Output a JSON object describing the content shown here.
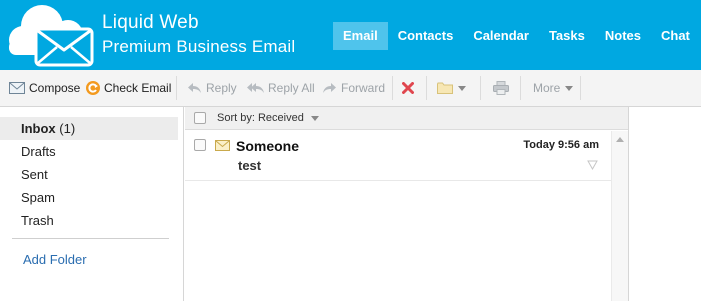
{
  "brand": {
    "line1": "Liquid Web",
    "line2": "Premium Business Email"
  },
  "nav": [
    {
      "label": "Email",
      "active": true
    },
    {
      "label": "Contacts"
    },
    {
      "label": "Calendar"
    },
    {
      "label": "Tasks"
    },
    {
      "label": "Notes"
    },
    {
      "label": "Chat"
    }
  ],
  "toolbar": {
    "compose": "Compose",
    "check_email": "Check Email",
    "reply": "Reply",
    "reply_all": "Reply All",
    "forward": "Forward",
    "more": "More"
  },
  "folders": [
    {
      "label": "Inbox",
      "count": "(1)",
      "active": true
    },
    {
      "label": "Drafts"
    },
    {
      "label": "Sent"
    },
    {
      "label": "Spam"
    },
    {
      "label": "Trash"
    }
  ],
  "add_folder": "Add Folder",
  "list": {
    "sort_label": "Sort by: Received",
    "messages": [
      {
        "sender": "Someone",
        "subject": "test",
        "time": "Today 9:56 am",
        "unread": true
      }
    ]
  },
  "colors": {
    "header": "#00a8e1",
    "nav_active": "#4fc4ec",
    "link": "#2a6db0",
    "delete": "#e0464e"
  },
  "icons": [
    "envelope-logo-icon",
    "compose-icon",
    "check-email-icon",
    "reply-icon",
    "reply-all-icon",
    "forward-icon",
    "delete-icon",
    "folder-icon",
    "print-icon",
    "envelope-icon",
    "flag-icon"
  ]
}
